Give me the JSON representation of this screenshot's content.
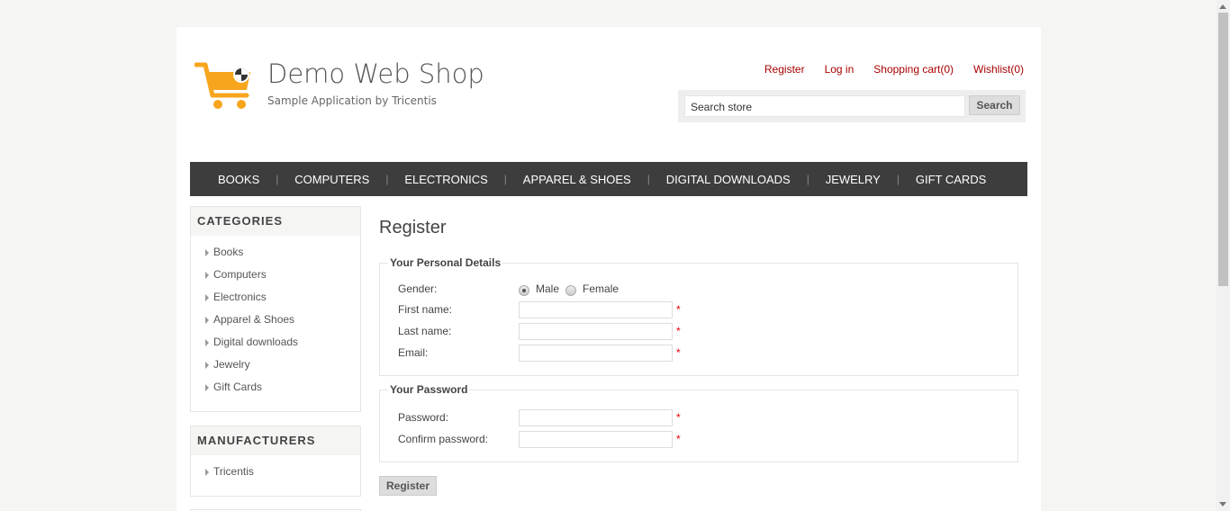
{
  "header": {
    "title": "Demo Web Shop",
    "subtitle": "Sample Application by Tricentis",
    "links": {
      "register": "Register",
      "login": "Log in",
      "cart": "Shopping cart(0)",
      "wishlist": "Wishlist(0)"
    },
    "search": {
      "placeholder": "Search store",
      "button": "Search"
    }
  },
  "top_menu": [
    "BOOKS",
    "COMPUTERS",
    "ELECTRONICS",
    "APPAREL & SHOES",
    "DIGITAL DOWNLOADS",
    "JEWELRY",
    "GIFT CARDS"
  ],
  "categories": {
    "title": "CATEGORIES",
    "items": [
      "Books",
      "Computers",
      "Electronics",
      "Apparel & Shoes",
      "Digital downloads",
      "Jewelry",
      "Gift Cards"
    ]
  },
  "manufacturers": {
    "title": "MANUFACTURERS",
    "items": [
      "Tricentis"
    ]
  },
  "main": {
    "title": "Register",
    "personal": {
      "legend": "Your Personal Details",
      "gender_label": "Gender:",
      "male": "Male",
      "female": "Female",
      "first_name": "First name:",
      "last_name": "Last name:",
      "email": "Email:",
      "required": "*"
    },
    "password": {
      "legend": "Your Password",
      "password": "Password:",
      "confirm": "Confirm password:",
      "required": "*"
    },
    "register_button": "Register"
  },
  "colors": {
    "link": "#aa0000",
    "menu_bg": "#3d3d3d",
    "logo": "#f7a51c"
  }
}
